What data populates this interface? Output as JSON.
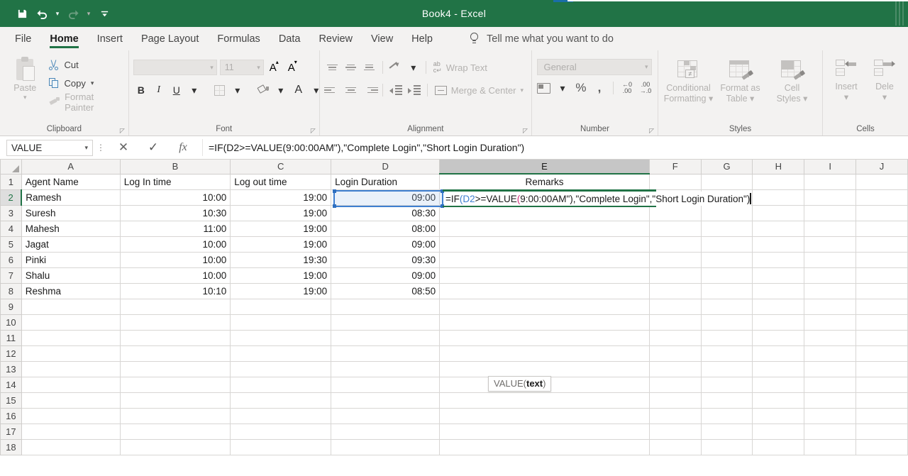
{
  "titlebar": {
    "document_title": "Book4  -  Excel",
    "quick_access": [
      {
        "name": "save",
        "icon": "save-icon",
        "enabled": true
      },
      {
        "name": "undo",
        "icon": "undo-icon",
        "enabled": true
      },
      {
        "name": "redo",
        "icon": "redo-icon",
        "enabled": false
      },
      {
        "name": "customize",
        "icon": "customize-quick-access-icon",
        "enabled": true
      }
    ],
    "accent_color": "#217346"
  },
  "tabs": [
    {
      "label": "File",
      "active": false
    },
    {
      "label": "Home",
      "active": true
    },
    {
      "label": "Insert",
      "active": false
    },
    {
      "label": "Page Layout",
      "active": false
    },
    {
      "label": "Formulas",
      "active": false
    },
    {
      "label": "Data",
      "active": false
    },
    {
      "label": "Review",
      "active": false
    },
    {
      "label": "View",
      "active": false
    },
    {
      "label": "Help",
      "active": false
    }
  ],
  "tellme": {
    "placeholder": "Tell me what you want to do",
    "icon": "lightbulb-icon"
  },
  "ribbon": {
    "clipboard": {
      "label": "Clipboard",
      "paste": "Paste",
      "cut": "Cut",
      "copy": "Copy",
      "format_painter": "Format Painter"
    },
    "font": {
      "label": "Font",
      "font_name": "",
      "font_size": "11",
      "bold": "B",
      "italic": "I",
      "underline": "U"
    },
    "alignment": {
      "label": "Alignment",
      "wrap_text": "Wrap Text",
      "merge_center": "Merge & Center"
    },
    "number": {
      "label": "Number",
      "format": "General",
      "percent": "%",
      "comma": ","
    },
    "styles": {
      "label": "Styles",
      "conditional_formatting": "Conditional\nFormatting",
      "conditional_formatting_l1": "Conditional",
      "conditional_formatting_l2": "Formatting",
      "format_as_table_l1": "Format as",
      "format_as_table_l2": "Table",
      "cell_styles_l1": "Cell",
      "cell_styles_l2": "Styles"
    },
    "cells": {
      "label": "Cells",
      "insert": "Insert",
      "delete": "Dele"
    }
  },
  "formula_bar": {
    "name_box": "VALUE",
    "cancel_icon": "cancel-x-icon",
    "enter_icon": "enter-check-icon",
    "function_icon": "insert-function-fx-icon",
    "formula": "=IF(D2>=VALUE(9:00:00AM\"),\"Complete Login\",\"Short Login Duration\")"
  },
  "grid": {
    "columns": [
      "A",
      "B",
      "C",
      "D",
      "E",
      "F",
      "G",
      "H",
      "I",
      "J"
    ],
    "active_column": "E",
    "active_row": 2,
    "rows": [
      {
        "num": "1",
        "A": "Agent Name",
        "B": "Log In time",
        "C": "Log out time",
        "D": "Login Duration",
        "E": "Remarks"
      },
      {
        "num": "2",
        "A": "Ramesh",
        "B": "10:00",
        "C": "19:00",
        "D": "09:00",
        "E": ""
      },
      {
        "num": "3",
        "A": "Suresh",
        "B": "10:30",
        "C": "19:00",
        "D": "08:30",
        "E": ""
      },
      {
        "num": "4",
        "A": "Mahesh",
        "B": "11:00",
        "C": "19:00",
        "D": "08:00",
        "E": ""
      },
      {
        "num": "5",
        "A": "Jagat",
        "B": "10:00",
        "C": "19:00",
        "D": "09:00",
        "E": ""
      },
      {
        "num": "6",
        "A": "Pinki",
        "B": "10:00",
        "C": "19:30",
        "D": "09:30",
        "E": ""
      },
      {
        "num": "7",
        "A": "Shalu",
        "B": "10:00",
        "C": "19:00",
        "D": "09:00",
        "E": ""
      },
      {
        "num": "8",
        "A": "Reshma",
        "B": "10:10",
        "C": "19:00",
        "D": "08:50",
        "E": ""
      },
      {
        "num": "9",
        "A": "",
        "B": "",
        "C": "",
        "D": "",
        "E": ""
      },
      {
        "num": "10",
        "A": "",
        "B": "",
        "C": "",
        "D": "",
        "E": ""
      },
      {
        "num": "11",
        "A": "",
        "B": "",
        "C": "",
        "D": "",
        "E": ""
      },
      {
        "num": "12",
        "A": "",
        "B": "",
        "C": "",
        "D": "",
        "E": ""
      },
      {
        "num": "13",
        "A": "",
        "B": "",
        "C": "",
        "D": "",
        "E": ""
      },
      {
        "num": "14",
        "A": "",
        "B": "",
        "C": "",
        "D": "",
        "E": ""
      },
      {
        "num": "15",
        "A": "",
        "B": "",
        "C": "",
        "D": "",
        "E": ""
      },
      {
        "num": "16",
        "A": "",
        "B": "",
        "C": "",
        "D": "",
        "E": ""
      },
      {
        "num": "17",
        "A": "",
        "B": "",
        "C": "",
        "D": "",
        "E": ""
      },
      {
        "num": "18",
        "A": "",
        "B": "",
        "C": "",
        "D": "",
        "E": ""
      }
    ]
  },
  "cell_editor": {
    "cell": "E2",
    "parts": {
      "p1": "=IF",
      "p2": "(",
      "p3": "D2",
      "p4": ">=VALUE",
      "p5": "(",
      "p6": "9:00:00AM\"),\"Complete Login\",\"Short Login Duration\")"
    },
    "reference_color": "#3f7fd0",
    "paren_color": "#d42a7a"
  },
  "tooltip": {
    "function": "VALUE(",
    "argument": "text",
    "close": ")"
  }
}
